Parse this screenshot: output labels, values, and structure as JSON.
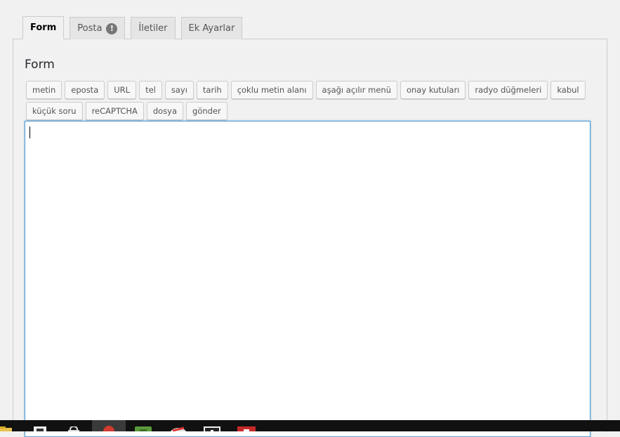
{
  "tabs": [
    {
      "label": "Form",
      "active": true
    },
    {
      "label": "Posta",
      "active": false,
      "badge": "!"
    },
    {
      "label": "İletiler",
      "active": false
    },
    {
      "label": "Ek Ayarlar",
      "active": false
    }
  ],
  "panel": {
    "title": "Form"
  },
  "tag_buttons": {
    "row1": [
      "metin",
      "eposta",
      "URL",
      "tel",
      "sayı",
      "tarih",
      "çoklu metin alanı",
      "aşağı açılır menü",
      "onay kutuları",
      "radyo düğmeleri",
      "kabul"
    ],
    "row2": [
      "küçük soru",
      "reCAPTCHA",
      "dosya",
      "gönder"
    ]
  },
  "editor": {
    "value": ""
  },
  "colors": {
    "editor_focus_border": "#5b9dd9",
    "taskbar": "#111111"
  },
  "taskbar_icons": [
    "folder-icon",
    "store-icon",
    "shopping-bag-icon",
    "chrome-icon",
    "app-green-icon",
    "app-red-white-icon",
    "app-dark-icon",
    "app-red-icon"
  ]
}
